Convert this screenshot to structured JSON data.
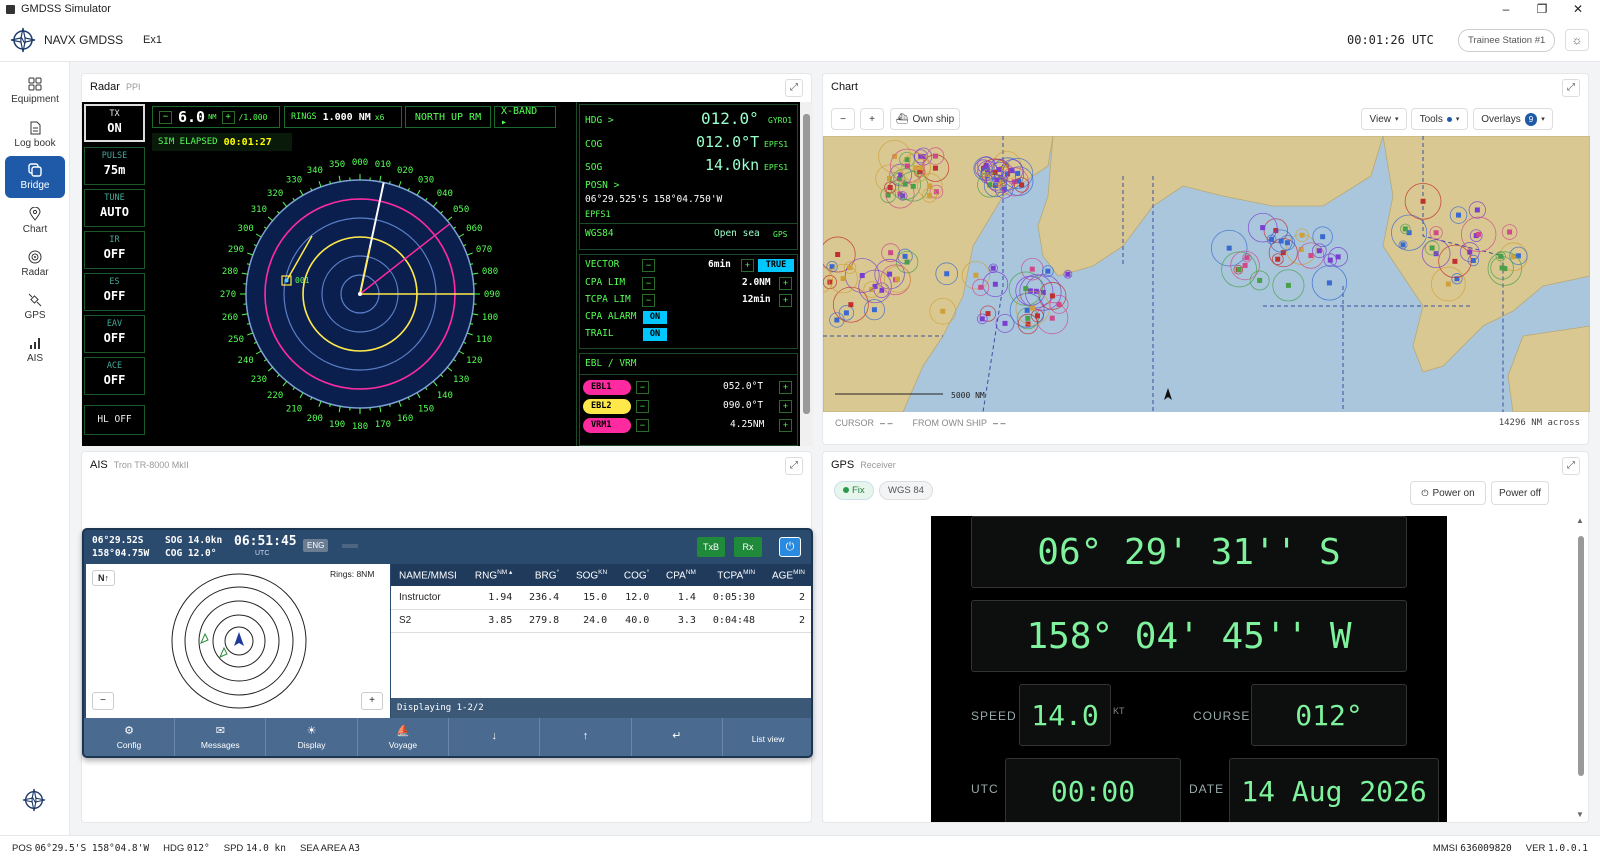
{
  "window": {
    "title": "GMDSS Simulator",
    "minimize": "–",
    "maximize": "❐",
    "close": "✕"
  },
  "app": {
    "name": "NAVX GMDSS",
    "exercise": "Ex1",
    "clock": "00:01:26 UTC",
    "station": "Trainee Station #1"
  },
  "nav": [
    {
      "label": "Equipment"
    },
    {
      "label": "Log book"
    },
    {
      "label": "Bridge"
    },
    {
      "label": "Chart"
    },
    {
      "label": "Radar"
    },
    {
      "label": "GPS"
    },
    {
      "label": "AIS"
    }
  ],
  "radar": {
    "title": "Radar",
    "subtitle": "PPI",
    "tx": {
      "label": "TX",
      "value": "ON"
    },
    "buttons": [
      {
        "label": "PULSE",
        "value": "75m"
      },
      {
        "label": "TUNE",
        "value": "AUTO"
      },
      {
        "label": "IR",
        "value": "OFF"
      },
      {
        "label": "ES",
        "value": "OFF"
      },
      {
        "label": "EAV",
        "value": "OFF"
      },
      {
        "label": "ACE",
        "value": "OFF"
      }
    ],
    "hl": "HL OFF",
    "range": "6.0",
    "range_unit": "NM",
    "range_scale": "/1.000",
    "rings_label": "RINGS",
    "rings_value": "1.000 NM",
    "rings_count": "x6",
    "mode": "NORTH UP RM",
    "band": "X-BAND ▸",
    "elapsed_label": "SIM ELAPSED",
    "elapsed": "00:01:27",
    "target_label": "001",
    "bearings": [
      "000",
      "010",
      "020",
      "030",
      "040",
      "050",
      "060",
      "070",
      "080",
      "090",
      "100",
      "110",
      "120",
      "130",
      "140",
      "150",
      "160",
      "170",
      "180",
      "190",
      "200",
      "210",
      "220",
      "230",
      "240",
      "250",
      "260",
      "270",
      "280",
      "290",
      "300",
      "310",
      "320",
      "330",
      "340",
      "350"
    ],
    "hdg": {
      "label": "HDG >",
      "value": "012.0°",
      "src": "GYRO1"
    },
    "cog": {
      "label": "COG",
      "value": "012.0°T",
      "src": "EPFS1"
    },
    "sog": {
      "label": "SOG",
      "value": "14.0kn",
      "src": "EPFS1"
    },
    "posn": {
      "label": "POSN >",
      "value": "06°29.525'S 158°04.750'W",
      "src": "EPFS1"
    },
    "datum": {
      "label": "WGS84",
      "value": "Open sea",
      "src": "GPS"
    },
    "vector": {
      "label": "VECTOR",
      "value": "6min",
      "mode": "TRUE"
    },
    "cpa": {
      "label": "CPA LIM",
      "value": "2.0NM"
    },
    "tcpa": {
      "label": "TCPA LIM",
      "value": "12min"
    },
    "cpa_alarm": {
      "label": "CPA ALARM",
      "value": "ON"
    },
    "trail": {
      "label": "TRAIL",
      "value": "ON"
    },
    "ebl_header": "EBL / VRM",
    "ebl1": {
      "label": "EBL1",
      "value": "052.0°T"
    },
    "ebl2": {
      "label": "EBL2",
      "value": "090.0°T"
    },
    "vrm1": {
      "label": "VRM1",
      "value": "4.25NM"
    }
  },
  "chart": {
    "title": "Chart",
    "minus": "−",
    "plus": "+",
    "own_ship": "Own ship",
    "view": "View",
    "tools": "Tools",
    "overlays": "Overlays",
    "overlays_count": "9",
    "scale": "5000 NM",
    "cursor_label": "CURSOR",
    "cursor_value": "– –",
    "from_label": "FROM OWN SHIP",
    "from_value": "– –",
    "across": "14296 NM across"
  },
  "ais": {
    "title": "AIS",
    "subtitle": "Tron TR-8000 MkII",
    "lat": "06°29.52S",
    "lon": "158°04.75W",
    "sog": "SOG 14.0kn",
    "cog": "COG 12.0°",
    "time": "06:51:45",
    "time_unit": "UTC",
    "lang": "ENG",
    "txb": "TxB",
    "rx": "Rx",
    "north": "N↑",
    "rings": "Rings: 8NM",
    "minus": "−",
    "plus": "+",
    "columns": [
      {
        "name": "NAME/MMSI",
        "unit": ""
      },
      {
        "name": "RNG",
        "unit": "NM ▴"
      },
      {
        "name": "BRG",
        "unit": "°"
      },
      {
        "name": "SOG",
        "unit": "KN"
      },
      {
        "name": "COG",
        "unit": "°"
      },
      {
        "name": "CPA",
        "unit": "NM"
      },
      {
        "name": "TCPA",
        "unit": "MIN"
      },
      {
        "name": "AGE",
        "unit": "MIN"
      }
    ],
    "rows": [
      [
        "Instructor",
        "1.94",
        "236.4",
        "15.0",
        "12.0",
        "1.4",
        "0:05:30",
        "2"
      ],
      [
        "S2",
        "3.85",
        "279.8",
        "24.0",
        "40.0",
        "3.3",
        "0:04:48",
        "2"
      ]
    ],
    "displaying": "Displaying 1-2/2",
    "buttons": [
      {
        "icon": "⚙",
        "label": "Config"
      },
      {
        "icon": "✉",
        "label": "Messages"
      },
      {
        "icon": "☀",
        "label": "Display"
      },
      {
        "icon": "⛵",
        "label": "Voyage"
      },
      {
        "icon": "↓",
        "label": ""
      },
      {
        "icon": "↑",
        "label": ""
      },
      {
        "icon": "↵",
        "label": ""
      },
      {
        "icon": "",
        "label": "List view"
      }
    ]
  },
  "gps": {
    "title": "GPS",
    "subtitle": "Receiver",
    "fix": "Fix",
    "datum": "WGS 84",
    "power_on": "Power on",
    "power_off": "Power off",
    "lat": "06° 29' 31'' S",
    "lon": "158° 04' 45'' W",
    "speed_label": "SPEED",
    "speed": "14.0",
    "speed_unit": "KT",
    "course_label": "COURSE",
    "course": "012°",
    "utc_label": "UTC",
    "utc": "00:00",
    "date_label": "DATE",
    "date": "14 Aug 2026"
  },
  "status": {
    "pos_label": "POS",
    "pos": "06°29.5'S 158°04.8'W",
    "hdg_label": "HDG",
    "hdg": "012°",
    "spd_label": "SPD",
    "spd": "14.0 kn",
    "sea_label": "SEA AREA",
    "sea": "A3",
    "mmsi_label": "MMSI",
    "mmsi": "636009820",
    "ver_label": "VER",
    "ver": "1.0.0.1"
  }
}
